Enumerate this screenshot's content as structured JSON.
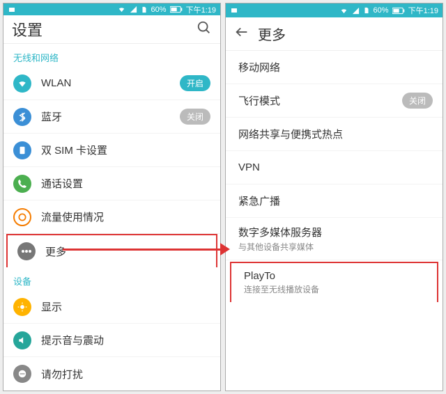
{
  "statusbar": {
    "battery": "60%",
    "time": "下午1:19"
  },
  "left": {
    "title": "设置",
    "section1": "无线和网络",
    "items1": {
      "wlan": {
        "label": "WLAN",
        "toggle": "开启"
      },
      "bt": {
        "label": "蓝牙",
        "toggle": "关闭"
      },
      "sim": {
        "label": "双 SIM 卡设置"
      },
      "call": {
        "label": "通话设置"
      },
      "data": {
        "label": "流量使用情况"
      },
      "more": {
        "label": "更多"
      }
    },
    "section2": "设备",
    "items2": {
      "display": {
        "label": "显示"
      },
      "sound": {
        "label": "提示音与震动"
      },
      "dnd": {
        "label": "请勿打扰"
      }
    }
  },
  "right": {
    "title": "更多",
    "items": {
      "mobile": {
        "label": "移动网络"
      },
      "airplane": {
        "label": "飞行模式",
        "toggle": "关闭"
      },
      "tether": {
        "label": "网络共享与便携式热点"
      },
      "vpn": {
        "label": "VPN"
      },
      "broadcast": {
        "label": "紧急广播"
      },
      "dms": {
        "label": "数字多媒体服务器",
        "sub": "与其他设备共享媒体"
      },
      "playto": {
        "label": "PlayTo",
        "sub": "连接至无线播放设备"
      }
    }
  }
}
